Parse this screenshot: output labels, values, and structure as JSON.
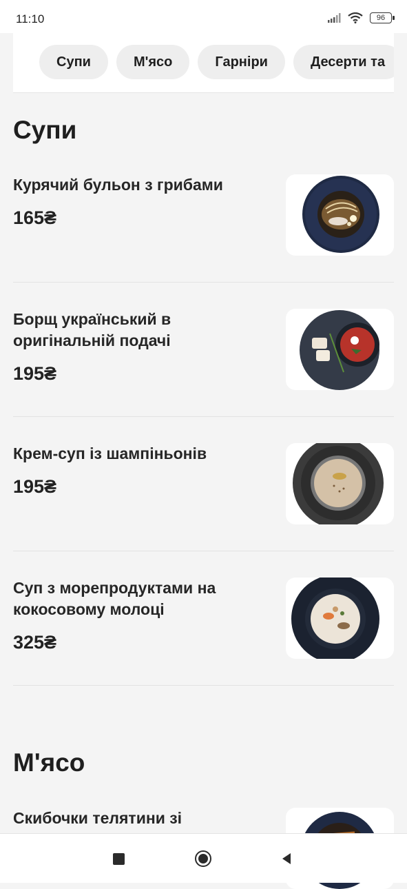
{
  "status": {
    "time": "11:10",
    "battery": "96"
  },
  "tabs": [
    "Супи",
    "М'ясо",
    "Гарніри",
    "Десерти та"
  ],
  "sections": [
    {
      "title": "Супи",
      "items": [
        {
          "name": "Курячий бульон з грибами",
          "price": "165₴",
          "image": "soup-bowl-broth"
        },
        {
          "name": "Борщ український в оригінальній подачі",
          "price": "195₴",
          "image": "borscht-plate"
        },
        {
          "name": "Крем-суп із шампіньонів",
          "price": "195₴",
          "image": "cream-soup-bowl"
        },
        {
          "name": "Суп з морепродуктами на кокосовому молоці",
          "price": "325₴",
          "image": "seafood-soup-bowl"
        }
      ]
    },
    {
      "title": "М'ясо",
      "items": [
        {
          "name": "Скибочки телятини зі",
          "price": "",
          "image": "veal-dish"
        }
      ]
    }
  ],
  "colors": {
    "background": "#f4f4f4",
    "card": "#ffffff",
    "tab": "#eeeeee",
    "text": "#1f1f1f"
  },
  "nav": {
    "icons": [
      "recent-apps-icon",
      "home-icon",
      "back-icon"
    ]
  }
}
